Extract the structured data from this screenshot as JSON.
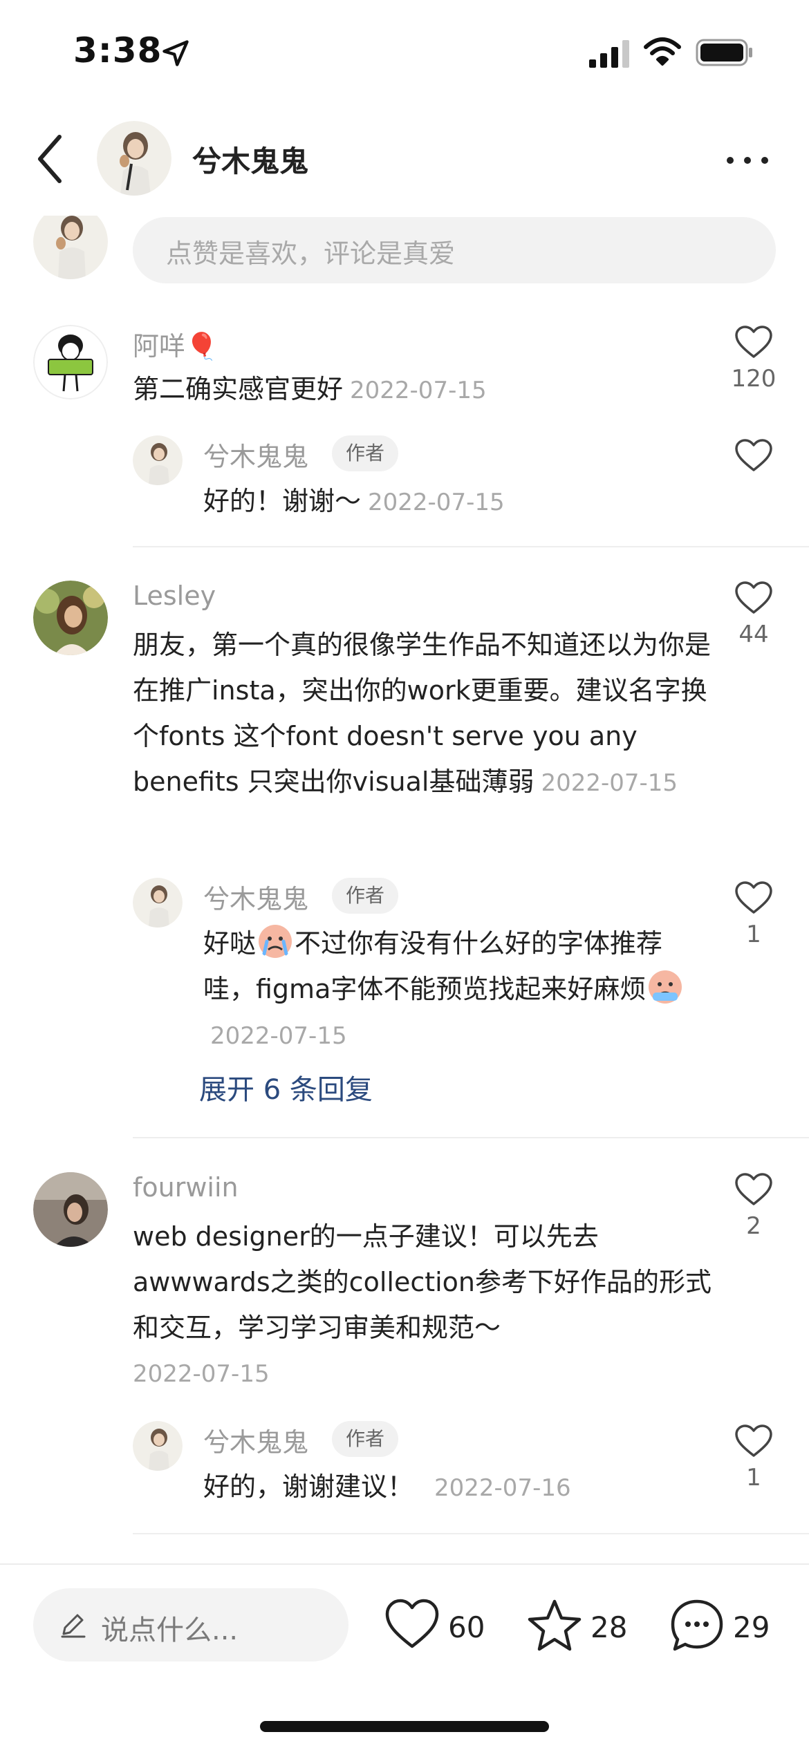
{
  "status_bar": {
    "time": "3:38"
  },
  "nav": {
    "title": "兮木鬼鬼"
  },
  "top_input": {
    "placeholder": "点赞是喜欢，评论是真爱"
  },
  "comments": [
    {
      "user": "阿咩🎈",
      "text": "第二确实感官更好",
      "date": "2022-07-15",
      "likes": "120",
      "reply": {
        "user": "兮木鬼鬼",
        "badge": "作者",
        "text": "好的！谢谢～",
        "date": "2022-07-15",
        "likes": ""
      }
    },
    {
      "user": "Lesley",
      "text": "朋友，第一个真的很像学生作品不知道还以为你是在推广insta，突出你的work更重要。建议名字换个fonts 这个font doesn't serve you any benefits 只突出你visual基础薄弱",
      "date": "2022-07-15",
      "likes": "44",
      "reply": {
        "user": "兮木鬼鬼",
        "badge": "作者",
        "text_a": "好哒",
        "text_b": "不过你有没有什么好的字体推荐哇，figma字体不能预览找起来好麻烦",
        "date": "2022-07-15",
        "likes": "1"
      },
      "expand_label": "展开 6 条回复"
    },
    {
      "user": "fourwiin",
      "text": "web designer的一点子建议！可以先去awwwards之类的collection参考下好作品的形式和交互，学习学习审美和规范～",
      "date": "2022-07-15",
      "likes": "2",
      "reply": {
        "user": "兮木鬼鬼",
        "badge": "作者",
        "text": "好的，谢谢建议！",
        "date": "2022-07-16",
        "likes": "1"
      }
    }
  ],
  "bottom_bar": {
    "input_placeholder": "说点什么...",
    "likes": "60",
    "favorites": "28",
    "comments": "29"
  },
  "colors": {
    "link": "#2b4a7e",
    "muted": "#a8a8a8",
    "text": "#222222"
  },
  "icons": [
    "location-arrow-icon",
    "signal-icon",
    "wifi-icon",
    "battery-icon",
    "back-chevron-icon",
    "more-icon",
    "heart-icon",
    "star-icon",
    "chat-bubble-icon",
    "pencil-icon"
  ]
}
